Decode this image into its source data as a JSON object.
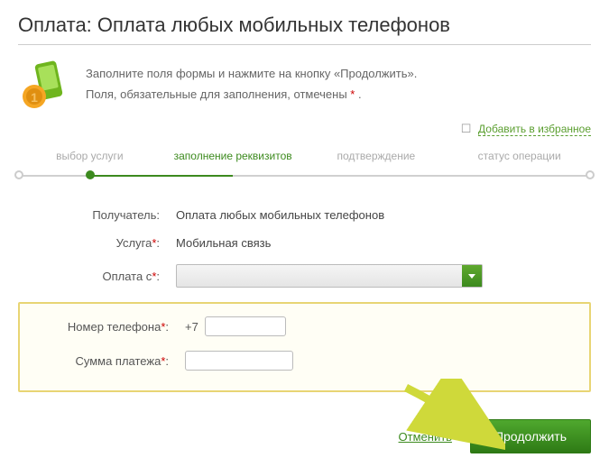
{
  "page_title": "Оплата: Оплата любых мобильных телефонов",
  "intro": {
    "line1": "Заполните поля формы и нажмите на кнопку «Продолжить».",
    "line2_prefix": "Поля, обязательные для заполнения, отмечены ",
    "line2_suffix": " ."
  },
  "favorites_label": "Добавить в избранное",
  "steps": {
    "s1": "выбор услуги",
    "s2": "заполнение реквизитов",
    "s3": "подтверждение",
    "s4": "статус операции"
  },
  "form": {
    "recipient_label": "Получатель:",
    "recipient_value": "Оплата любых мобильных телефонов",
    "service_label": "Услуга",
    "service_value": "Мобильная связь",
    "payfrom_label": "Оплата с",
    "phone_label": "Номер телефона",
    "phone_prefix": "+7",
    "amount_label": "Сумма платежа"
  },
  "buttons": {
    "cancel": "Отменить",
    "continue": "Продолжить"
  },
  "star": "*",
  "colon": ":"
}
